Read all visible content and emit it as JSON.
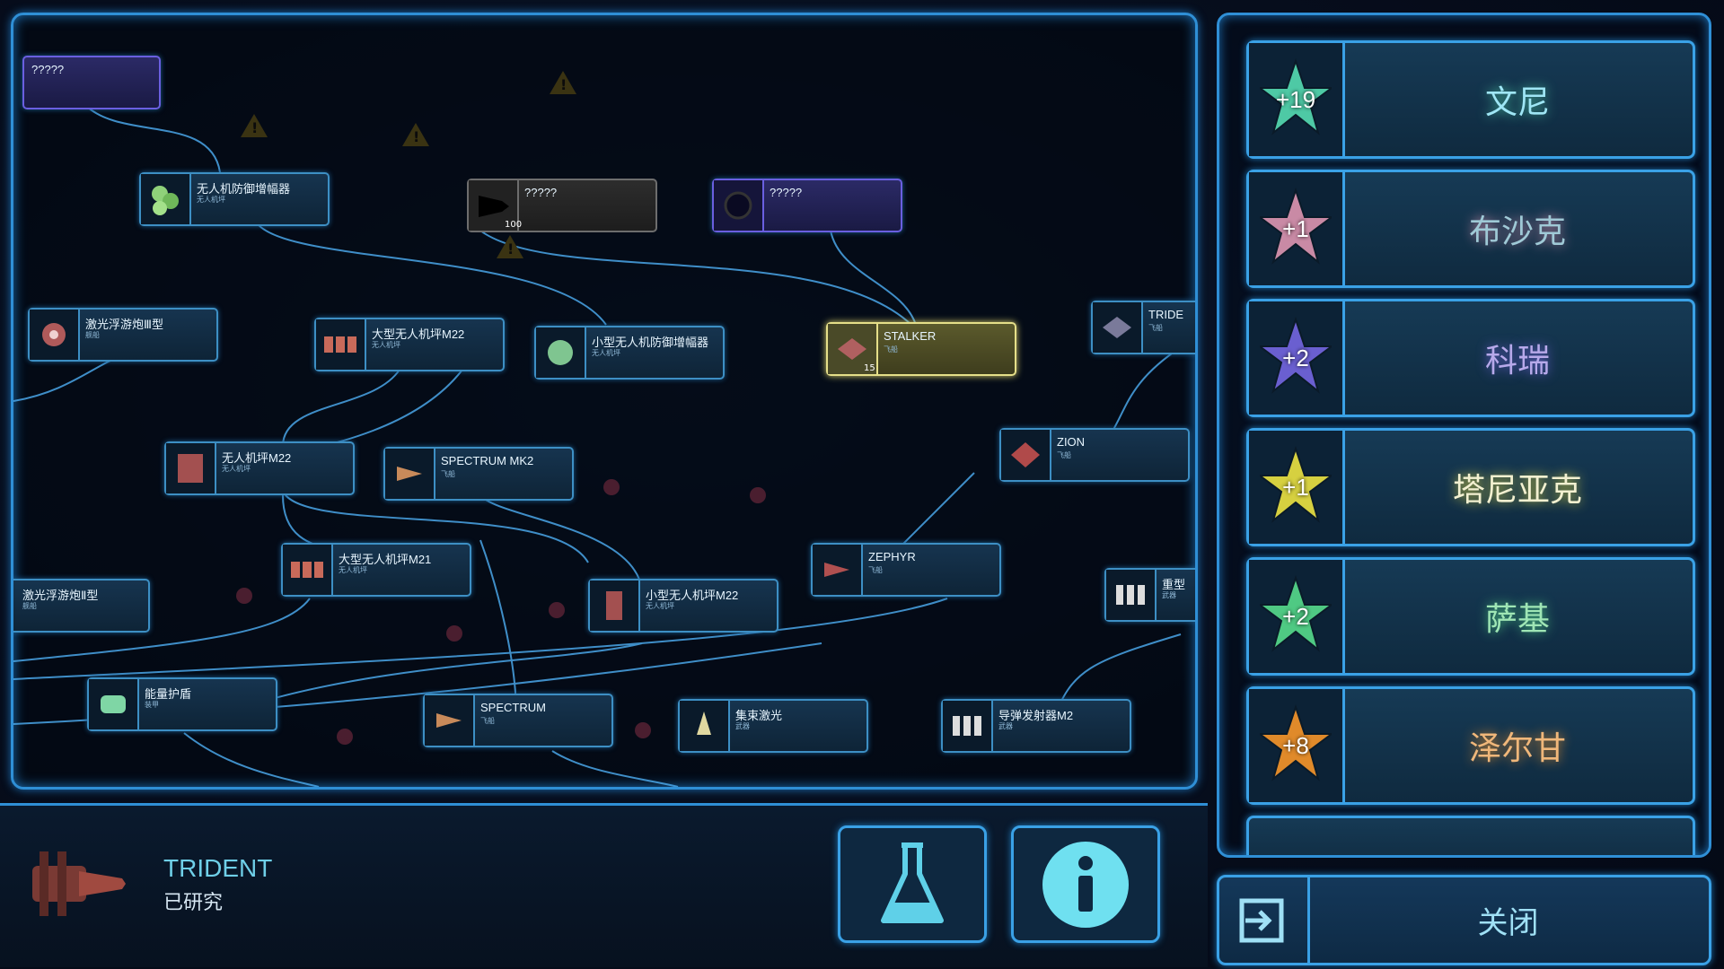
{
  "tree": {
    "nodes": [
      {
        "id": "n0",
        "name": "?????",
        "sub": "",
        "type": "purple"
      },
      {
        "id": "n1",
        "name": "无人机防御增幅器",
        "sub": "无人机坪",
        "type": "normal"
      },
      {
        "id": "n2",
        "name": "?????",
        "sub": "",
        "type": "unknown",
        "count": "100"
      },
      {
        "id": "n3",
        "name": "?????",
        "sub": "",
        "type": "purple"
      },
      {
        "id": "n4",
        "name": "激光浮游炮Ⅲ型",
        "sub": "舰船",
        "type": "normal"
      },
      {
        "id": "n5",
        "name": "大型无人机坪M22",
        "sub": "无人机坪",
        "type": "normal"
      },
      {
        "id": "n6",
        "name": "小型无人机防御增幅器",
        "sub": "无人机坪",
        "type": "normal"
      },
      {
        "id": "n7",
        "name": "STALKER",
        "sub": "飞船",
        "type": "selected",
        "count": "15"
      },
      {
        "id": "n8",
        "name": "TRIDE",
        "sub": "飞船",
        "type": "normal"
      },
      {
        "id": "n9",
        "name": "无人机坪M22",
        "sub": "无人机坪",
        "type": "normal"
      },
      {
        "id": "n10",
        "name": "SPECTRUM MK2",
        "sub": "飞船",
        "type": "normal"
      },
      {
        "id": "n11",
        "name": "ZION",
        "sub": "飞船",
        "type": "normal"
      },
      {
        "id": "n12",
        "name": "大型无人机坪M21",
        "sub": "无人机坪",
        "type": "normal"
      },
      {
        "id": "n13",
        "name": "激光浮游炮Ⅱ型",
        "sub": "舰船",
        "type": "normal"
      },
      {
        "id": "n14",
        "name": "小型无人机坪M22",
        "sub": "无人机坪",
        "type": "normal"
      },
      {
        "id": "n15",
        "name": "ZEPHYR",
        "sub": "飞船",
        "type": "normal"
      },
      {
        "id": "n16",
        "name": "重型",
        "sub": "武器",
        "type": "normal"
      },
      {
        "id": "n17",
        "name": "能量护盾",
        "sub": "装甲",
        "type": "normal"
      },
      {
        "id": "n18",
        "name": "SPECTRUM",
        "sub": "飞船",
        "type": "normal"
      },
      {
        "id": "n19",
        "name": "集束激光",
        "sub": "武器",
        "type": "normal"
      },
      {
        "id": "n20",
        "name": "导弹发射器M2",
        "sub": "武器",
        "type": "normal"
      }
    ]
  },
  "factions": [
    {
      "value": "+19",
      "name": "文尼",
      "star_color": "#4ec9a5",
      "text_color": "#9fe6f5"
    },
    {
      "value": "+1",
      "name": "布沙克",
      "star_color": "#c98aa5",
      "text_color": "#9fc9d6"
    },
    {
      "value": "+2",
      "name": "科瑞",
      "star_color": "#6a5fd0",
      "text_color": "#b7a9ea"
    },
    {
      "value": "+1",
      "name": "塔尼亚克",
      "star_color": "#d6d040",
      "text_color": "#f2f0d0"
    },
    {
      "value": "+2",
      "name": "萨基",
      "star_color": "#4fc983",
      "text_color": "#9fe6b5"
    },
    {
      "value": "+8",
      "name": "泽尔甘",
      "star_color": "#e08a2a",
      "text_color": "#f0b77a"
    }
  ],
  "selected": {
    "name": "TRIDENT",
    "status": "已研究"
  },
  "buttons": {
    "research": "flask-icon",
    "info": "info-icon",
    "close_label": "关闭"
  },
  "colors": {
    "accent": "#2f8fd6",
    "highlight": "#e5df89"
  }
}
